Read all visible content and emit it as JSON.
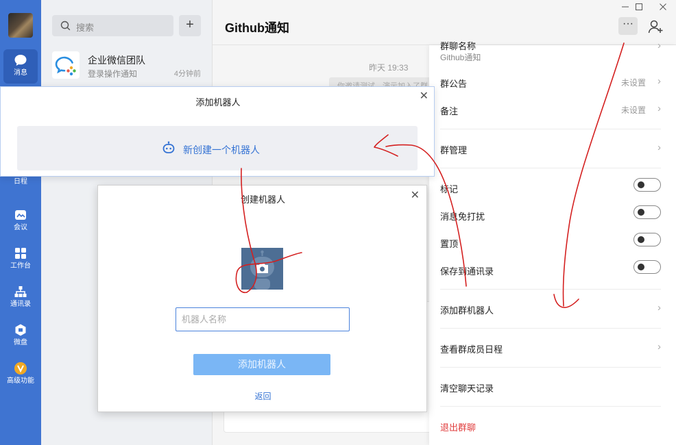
{
  "nav": {
    "items": [
      {
        "label": "消息",
        "icon": "chat-bubble-icon"
      },
      {
        "label": "日程",
        "icon": "calendar-icon"
      },
      {
        "label": "会议",
        "icon": "meeting-icon"
      },
      {
        "label": "工作台",
        "icon": "grid-icon"
      },
      {
        "label": "通讯录",
        "icon": "org-chart-icon"
      },
      {
        "label": "微盘",
        "icon": "drive-icon"
      },
      {
        "label": "高级功能",
        "icon": "vip-icon"
      }
    ]
  },
  "session": {
    "search_placeholder": "搜索",
    "add_label": "+",
    "conversations": [
      {
        "title": "企业微信团队",
        "subtitle": "登录操作通知",
        "time": "4分钟前"
      }
    ]
  },
  "chat": {
    "title": "Github通知",
    "more_label": "···",
    "timestamp": "昨天 19:33",
    "system_message": "你邀请测试，演示加入了群"
  },
  "panel": {
    "group_name_label": "群聊名称",
    "group_name_value": "Github通知",
    "rows": {
      "announcement": {
        "label": "群公告",
        "value": "未设置"
      },
      "remark": {
        "label": "备注",
        "value": "未设置"
      },
      "manage": {
        "label": "群管理"
      },
      "mark": {
        "label": "标记"
      },
      "mute": {
        "label": "消息免打扰"
      },
      "pin": {
        "label": "置顶"
      },
      "save_contacts": {
        "label": "保存到通讯录"
      },
      "add_bot": {
        "label": "添加群机器人"
      },
      "member_schedule": {
        "label": "查看群成员日程"
      },
      "clear_history": {
        "label": "清空聊天记录"
      },
      "leave": {
        "label": "退出群聊"
      }
    }
  },
  "add_bot_dialog": {
    "title": "添加机器人",
    "new_bot_label": "新创建一个机器人"
  },
  "create_bot_dialog": {
    "title": "创建机器人",
    "name_placeholder": "机器人名称",
    "submit_label": "添加机器人",
    "back_label": "返回"
  },
  "colors": {
    "nav_bg": "#3f74d1",
    "accent": "#3573d4",
    "danger": "#e03c3c",
    "annotation": "#d42020"
  }
}
